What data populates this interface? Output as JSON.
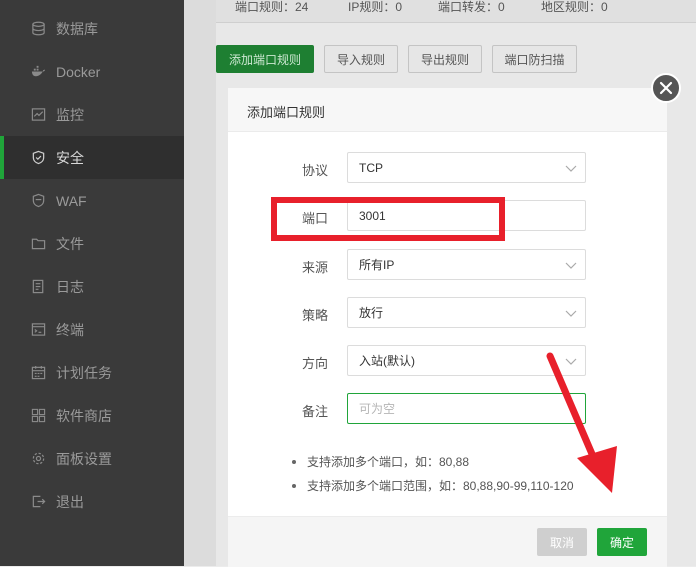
{
  "sidebar": {
    "items": [
      {
        "label": "数据库",
        "icon": "database-icon"
      },
      {
        "label": "Docker",
        "icon": "docker-icon"
      },
      {
        "label": "监控",
        "icon": "monitor-icon"
      },
      {
        "label": "安全",
        "icon": "shield-icon",
        "active": true
      },
      {
        "label": "WAF",
        "icon": "waf-shield-icon"
      },
      {
        "label": "文件",
        "icon": "folder-icon"
      },
      {
        "label": "日志",
        "icon": "log-icon"
      },
      {
        "label": "终端",
        "icon": "terminal-icon"
      },
      {
        "label": "计划任务",
        "icon": "calendar-icon"
      },
      {
        "label": "软件商店",
        "icon": "grid-icon"
      },
      {
        "label": "面板设置",
        "icon": "gear-icon"
      },
      {
        "label": "退出",
        "icon": "logout-icon"
      }
    ]
  },
  "tabs": [
    {
      "label": "端口规则：24"
    },
    {
      "label": "IP规则：0"
    },
    {
      "label": "端口转发：0"
    },
    {
      "label": "地区规则：0"
    }
  ],
  "toolbar": {
    "add_port_rule": "添加端口规则",
    "import_rules": "导入规则",
    "export_rules": "导出规则",
    "port_anti_scan": "端口防扫描"
  },
  "modal": {
    "title": "添加端口规则",
    "protocol": {
      "label": "协议",
      "value": "TCP"
    },
    "port": {
      "label": "端口",
      "value": "3001"
    },
    "source": {
      "label": "来源",
      "value": "所有IP"
    },
    "strategy": {
      "label": "策略",
      "value": "放行"
    },
    "direction": {
      "label": "方向",
      "value": "入站(默认)"
    },
    "remark": {
      "label": "备注",
      "placeholder": "可为空"
    },
    "notes": [
      "支持添加多个端口，如：80,88",
      "支持添加多个端口范围，如：80,88,90-99,110-120"
    ],
    "cancel_label": "取消",
    "confirm_label": "确定"
  },
  "colors": {
    "accent": "#20a53a",
    "annotation": "#e8202b"
  }
}
